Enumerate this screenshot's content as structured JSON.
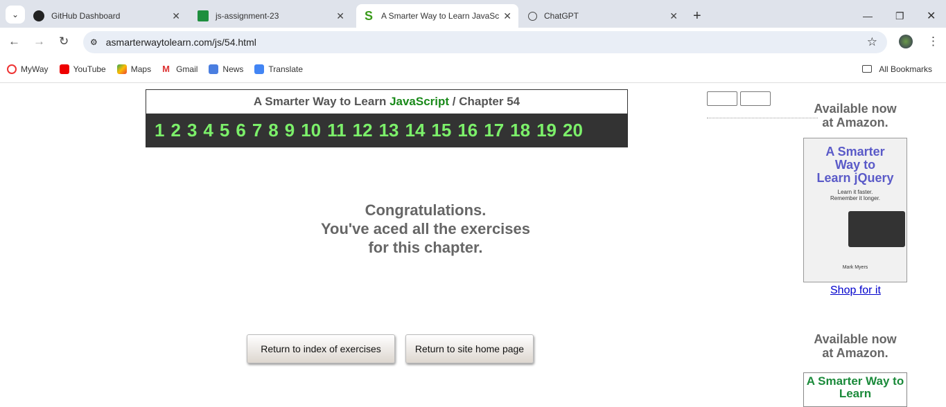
{
  "tabs": [
    {
      "title": "GitHub Dashboard"
    },
    {
      "title": "js-assignment-23"
    },
    {
      "title": "A Smarter Way to Learn JavaScri"
    },
    {
      "title": "ChatGPT"
    }
  ],
  "url": "asmarterwaytolearn.com/js/54.html",
  "bookmarks": [
    "MyWay",
    "YouTube",
    "Maps",
    "Gmail",
    "News",
    "Translate"
  ],
  "all_bookmarks": "All Bookmarks",
  "header": {
    "prefix": "A Smarter Way to Learn ",
    "brand": "JavaScript",
    "sep": " / ",
    "chapter": "Chapter 54"
  },
  "exercises": [
    "1",
    "2",
    "3",
    "4",
    "5",
    "6",
    "7",
    "8",
    "9",
    "10",
    "11",
    "12",
    "13",
    "14",
    "15",
    "16",
    "17",
    "18",
    "19",
    "20"
  ],
  "message": [
    "Congratulations.",
    "You've aced all the exercises",
    "for this chapter."
  ],
  "buttons": {
    "index": "Return to index of exercises",
    "home": "Return to site home page"
  },
  "ad": {
    "available": "Available now",
    "amazon": "at Amazon.",
    "book_title": "A Smarter Way to Learn jQuery",
    "tagline1": "Learn it faster.",
    "tagline2": "Remember it longer.",
    "author": "Mark Myers",
    "shop": "Shop for it",
    "book2_title": "A Smarter Way to Learn"
  },
  "colors": {
    "brand": "#1a8a1a",
    "numbers": "#7cf06a"
  }
}
